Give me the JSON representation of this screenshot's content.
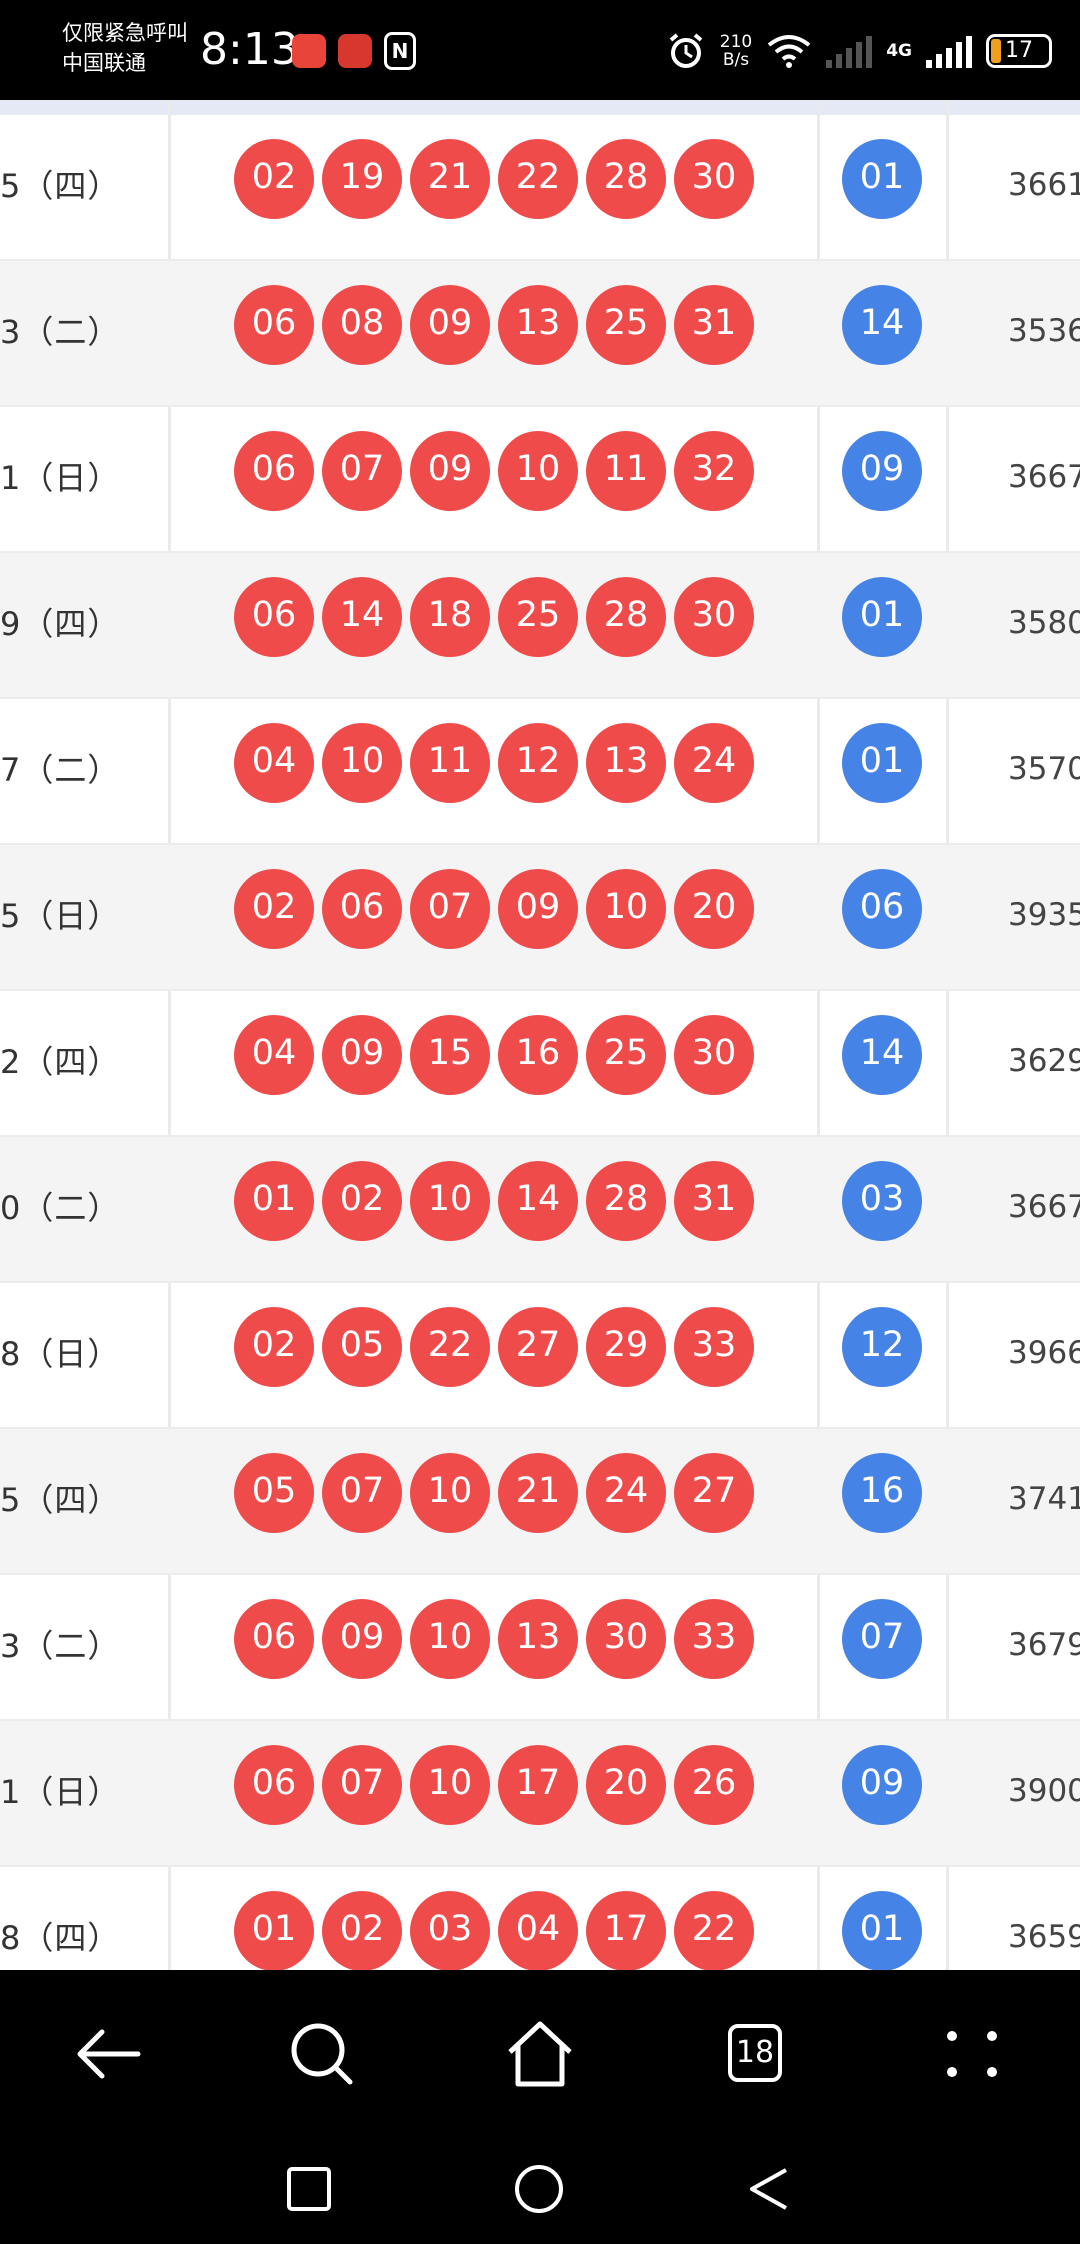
{
  "status_bar": {
    "carrier_line1": "仅限紧急呼叫",
    "carrier_line2": "中国联通",
    "time": "8:13",
    "net_speed_value": "210",
    "net_speed_unit": "B/s",
    "network": "4G",
    "battery": "17",
    "nfc_label": "N",
    "icons": [
      "app-icon-1",
      "app-icon-2",
      "nfc-icon",
      "alarm-icon",
      "wifi-icon",
      "signal-icon",
      "battery-icon"
    ]
  },
  "draws": [
    {
      "date": "5（四）",
      "reds": [
        "02",
        "19",
        "21",
        "22",
        "28",
        "30"
      ],
      "blue": "01",
      "amount": "3661"
    },
    {
      "date": "3（二）",
      "reds": [
        "06",
        "08",
        "09",
        "13",
        "25",
        "31"
      ],
      "blue": "14",
      "amount": "3536"
    },
    {
      "date": "1（日）",
      "reds": [
        "06",
        "07",
        "09",
        "10",
        "11",
        "32"
      ],
      "blue": "09",
      "amount": "3667"
    },
    {
      "date": "9（四）",
      "reds": [
        "06",
        "14",
        "18",
        "25",
        "28",
        "30"
      ],
      "blue": "01",
      "amount": "3580"
    },
    {
      "date": "7（二）",
      "reds": [
        "04",
        "10",
        "11",
        "12",
        "13",
        "24"
      ],
      "blue": "01",
      "amount": "3570"
    },
    {
      "date": "5（日）",
      "reds": [
        "02",
        "06",
        "07",
        "09",
        "10",
        "20"
      ],
      "blue": "06",
      "amount": "3935"
    },
    {
      "date": "2（四）",
      "reds": [
        "04",
        "09",
        "15",
        "16",
        "25",
        "30"
      ],
      "blue": "14",
      "amount": "3629"
    },
    {
      "date": "0（二）",
      "reds": [
        "01",
        "02",
        "10",
        "14",
        "28",
        "31"
      ],
      "blue": "03",
      "amount": "3667"
    },
    {
      "date": "8（日）",
      "reds": [
        "02",
        "05",
        "22",
        "27",
        "29",
        "33"
      ],
      "blue": "12",
      "amount": "3966"
    },
    {
      "date": "5（四）",
      "reds": [
        "05",
        "07",
        "10",
        "21",
        "24",
        "27"
      ],
      "blue": "16",
      "amount": "3741"
    },
    {
      "date": "3（二）",
      "reds": [
        "06",
        "09",
        "10",
        "13",
        "30",
        "33"
      ],
      "blue": "07",
      "amount": "3679"
    },
    {
      "date": "1（日）",
      "reds": [
        "06",
        "07",
        "10",
        "17",
        "20",
        "26"
      ],
      "blue": "09",
      "amount": "3900"
    },
    {
      "date": "8（四）",
      "reds": [
        "01",
        "02",
        "03",
        "04",
        "17",
        "22"
      ],
      "blue": "01",
      "amount": "3659"
    }
  ],
  "browser_nav": {
    "tab_count": "18",
    "buttons": [
      "back-icon",
      "search-icon",
      "home-icon",
      "tabs-icon",
      "menu-icon"
    ]
  },
  "system_nav": {
    "buttons": [
      "recents-icon",
      "home-circle-icon",
      "back-triangle-icon"
    ]
  },
  "colors": {
    "red_ball": "#ef4b4b",
    "blue_ball": "#4683e6",
    "row_alt": "#f4f4f4",
    "header_strip": "#e4e9f5"
  }
}
